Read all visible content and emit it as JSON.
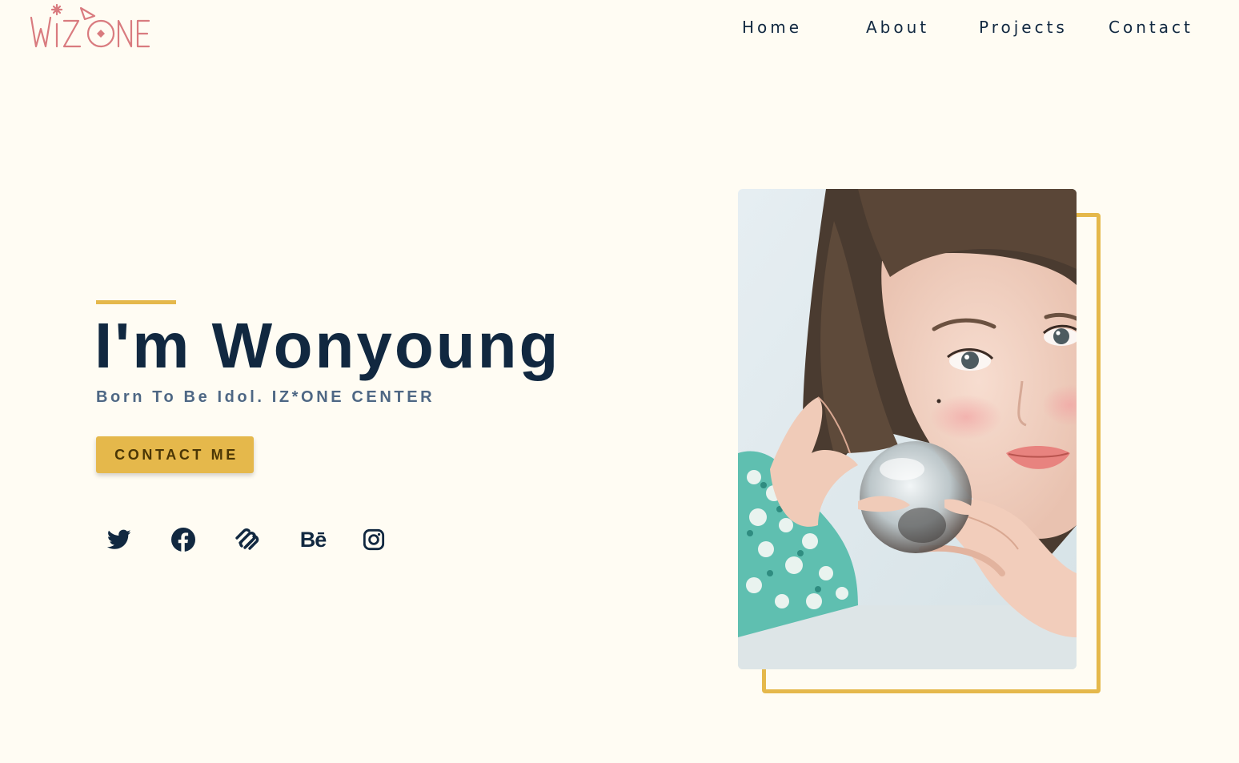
{
  "brand": {
    "logo_text": "WIZ*ONE",
    "logo_color": "#d97b7f"
  },
  "nav": {
    "home": "Home",
    "about": "About",
    "projects": "Projects",
    "contact": "Contact"
  },
  "hero": {
    "title": "I'm Wonyoung",
    "subtitle": "Born To Be Idol. IZ*ONE CENTER",
    "cta_label": "CONTACT ME"
  },
  "socials": [
    {
      "icon": "twitter-icon"
    },
    {
      "icon": "facebook-icon"
    },
    {
      "icon": "squarespace-icon"
    },
    {
      "icon": "behance-icon",
      "label": "Bē"
    },
    {
      "icon": "instagram-icon"
    }
  ],
  "colors": {
    "background": "#fffcf3",
    "accent": "#e5b84b",
    "primary_text": "#112840",
    "secondary_text": "#4e6784",
    "button_text": "#4a3605"
  }
}
